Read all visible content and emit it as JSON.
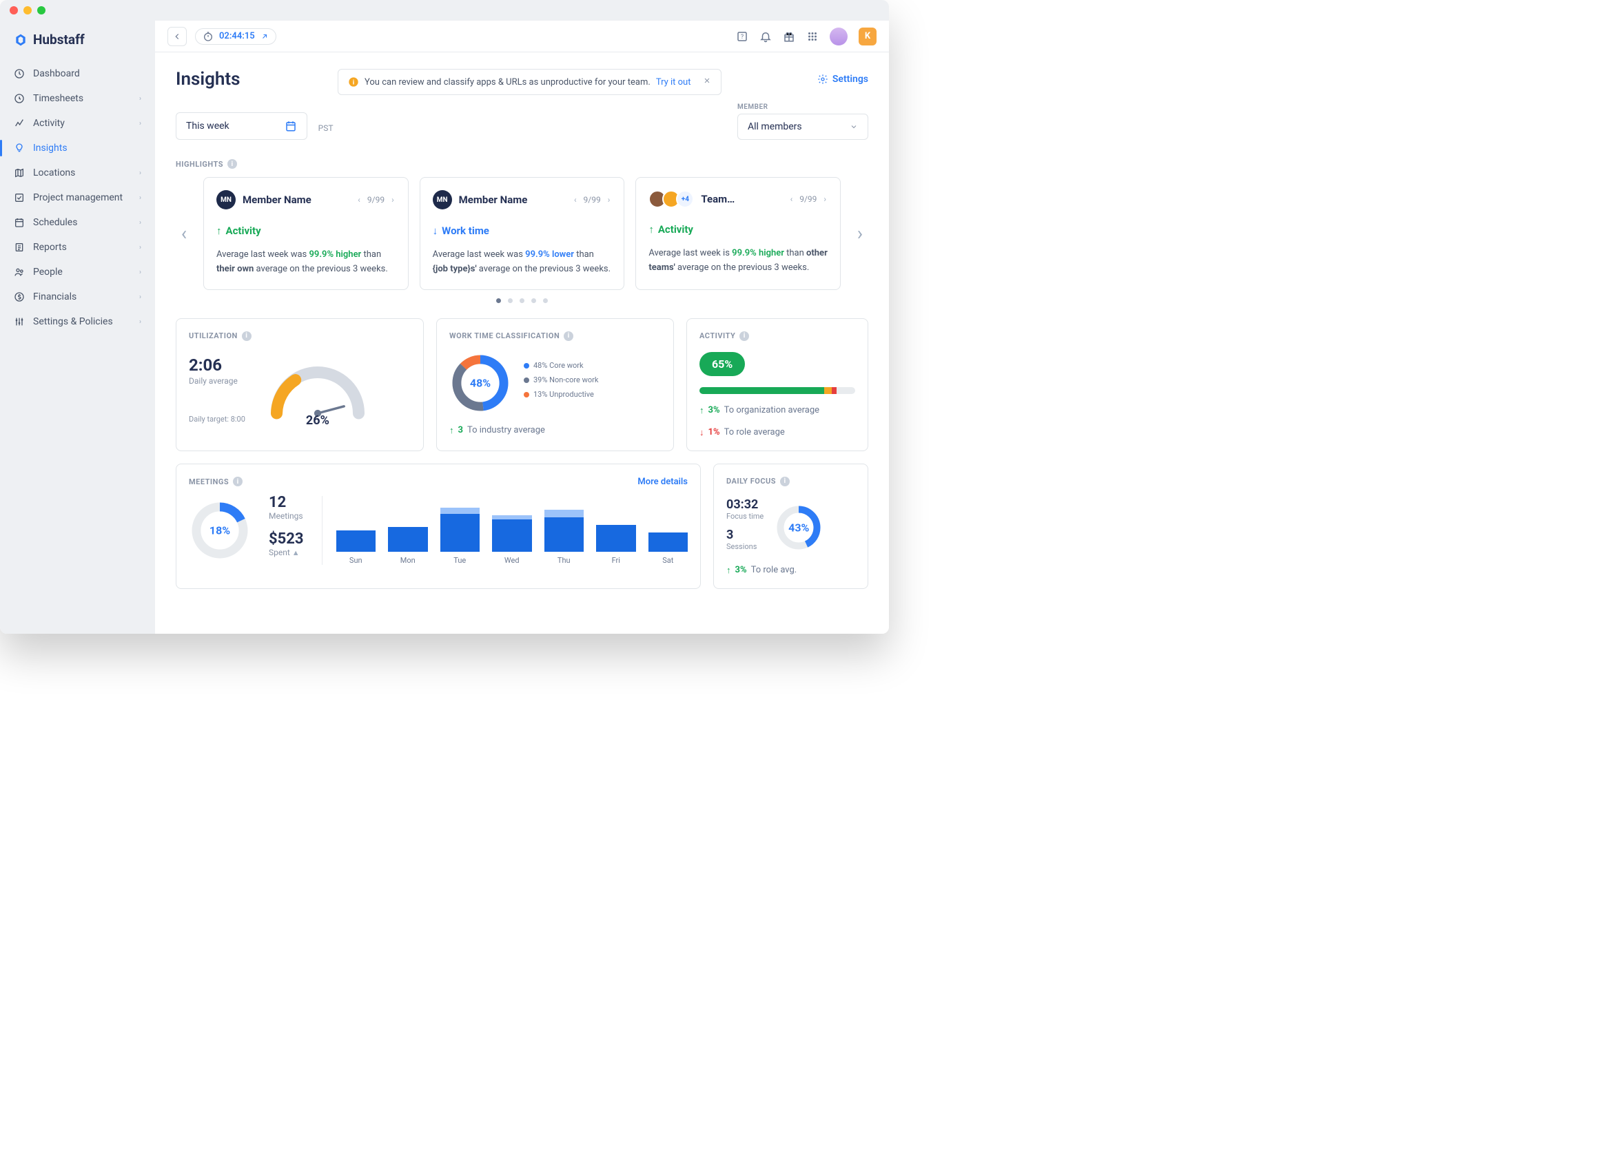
{
  "brand": "Hubstaff",
  "nav": [
    {
      "label": "Dashboard",
      "expandable": false
    },
    {
      "label": "Timesheets",
      "expandable": true
    },
    {
      "label": "Activity",
      "expandable": true
    },
    {
      "label": "Insights",
      "expandable": false,
      "active": true
    },
    {
      "label": "Locations",
      "expandable": true
    },
    {
      "label": "Project management",
      "expandable": true
    },
    {
      "label": "Schedules",
      "expandable": true
    },
    {
      "label": "Reports",
      "expandable": true
    },
    {
      "label": "People",
      "expandable": true
    },
    {
      "label": "Financials",
      "expandable": true
    },
    {
      "label": "Settings & Policies",
      "expandable": true
    }
  ],
  "topbar": {
    "timer": "02:44:15",
    "user_initial": "K"
  },
  "page": {
    "title": "Insights",
    "settings": "Settings"
  },
  "banner": {
    "text": "You can review and classify apps & URLs as unproductive for your team.",
    "cta": "Try it out"
  },
  "filters": {
    "range": "This week",
    "tz": "PST",
    "member_label": "MEMBER",
    "member_value": "All members"
  },
  "highlights": {
    "label": "HIGHLIGHTS",
    "cards": [
      {
        "avatar": "MN",
        "name": "Member Name",
        "pager": "9/99",
        "metric": "Activity",
        "dir": "up",
        "color": "green",
        "text_pre": "Average last week was ",
        "pct": "99.9% higher",
        "text_mid": " than ",
        "bold": "their own",
        "text_post": " average on the previous 3 weeks."
      },
      {
        "avatar": "MN",
        "name": "Member Name",
        "pager": "9/99",
        "metric": "Work time",
        "dir": "down",
        "color": "blue",
        "text_pre": "Average last week was ",
        "pct": "99.9% lower",
        "text_mid": " than ",
        "bold": "{job type}s'",
        "text_post": " average on the previous 3 weeks."
      },
      {
        "avatar": "team",
        "name": "Team…",
        "more": "+4",
        "pager": "9/99",
        "metric": "Activity",
        "dir": "up",
        "color": "green",
        "text_pre": "Average last week is ",
        "pct": "99.9% higher",
        "text_mid": " than ",
        "bold": "other teams'",
        "text_post": " average on the previous 3 weeks."
      }
    ]
  },
  "utilization": {
    "title": "UTILIZATION",
    "time": "2:06",
    "sub": "Daily average",
    "target": "Daily target: 8:00",
    "pct": "26%"
  },
  "worktime": {
    "title": "WORK TIME CLASSIFICATION",
    "pct": "48%",
    "legend": [
      {
        "color": "blue",
        "text": "48% Core work"
      },
      {
        "color": "gray",
        "text": "39% Non-core work"
      },
      {
        "color": "orange",
        "text": "13% Unproductive"
      }
    ],
    "compare": {
      "val": "3",
      "text": "To industry average"
    }
  },
  "activity": {
    "title": "ACTIVITY",
    "pct": "65%",
    "bars": [
      {
        "c": "#18a957",
        "w": 80
      },
      {
        "c": "#f5a623",
        "w": 5
      },
      {
        "c": "#e53e3e",
        "w": 3
      }
    ],
    "compares": [
      {
        "dir": "up",
        "val": "3%",
        "text": "To organization average"
      },
      {
        "dir": "down",
        "val": "1%",
        "text": "To role average"
      }
    ]
  },
  "meetings": {
    "title": "MEETINGS",
    "more": "More details",
    "donut_pct": "18%",
    "count": "12",
    "count_lbl": "Meetings",
    "spent": "$523",
    "spent_lbl": "Spent"
  },
  "focus": {
    "title": "DAILY FOCUS",
    "time": "03:32",
    "time_lbl": "Focus time",
    "sessions": "3",
    "sessions_lbl": "Sessions",
    "pct": "43%",
    "compare": {
      "val": "3%",
      "text": "To role avg."
    }
  },
  "chart_data": {
    "type": "bar",
    "title": "Meetings",
    "categories": [
      "Sun",
      "Mon",
      "Tue",
      "Wed",
      "Thu",
      "Fri",
      "Sat"
    ],
    "series": [
      {
        "name": "secondary",
        "values": [
          0,
          0,
          12,
          8,
          14,
          0,
          0
        ]
      },
      {
        "name": "primary",
        "values": [
          38,
          45,
          68,
          58,
          62,
          48,
          35
        ]
      }
    ],
    "ylim": [
      0,
      80
    ]
  }
}
